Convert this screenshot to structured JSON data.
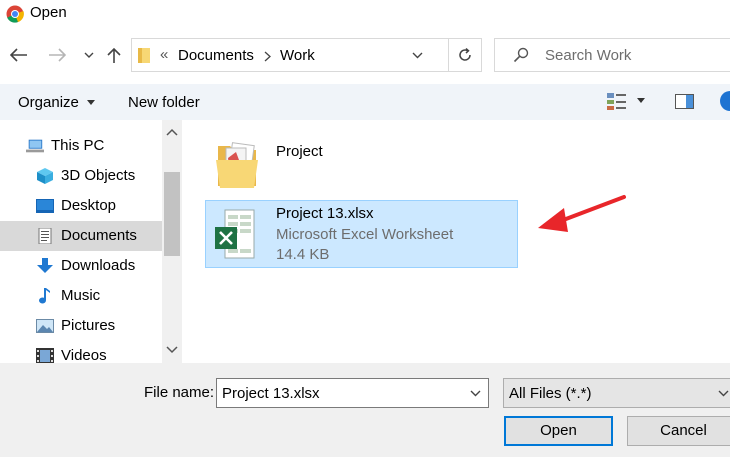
{
  "window": {
    "title": "Open"
  },
  "address": {
    "overflow": "«",
    "crumbs": [
      "Documents",
      "Work"
    ]
  },
  "search": {
    "placeholder": "Search Work"
  },
  "toolbar": {
    "organize": "Organize",
    "new_folder": "New folder"
  },
  "sidebar": {
    "items": [
      {
        "label": "This PC",
        "icon": "computer-icon"
      },
      {
        "label": "3D Objects",
        "icon": "cube-icon"
      },
      {
        "label": "Desktop",
        "icon": "desktop-icon"
      },
      {
        "label": "Documents",
        "icon": "document-icon",
        "selected": true
      },
      {
        "label": "Downloads",
        "icon": "download-arrow-icon"
      },
      {
        "label": "Music",
        "icon": "music-note-icon"
      },
      {
        "label": "Pictures",
        "icon": "picture-icon"
      },
      {
        "label": "Videos",
        "icon": "film-icon"
      }
    ]
  },
  "files": [
    {
      "name": "Project",
      "icon": "folder-icon"
    },
    {
      "name": "Project 13.xlsx",
      "type": "Microsoft Excel Worksheet",
      "size": "14.4 KB",
      "icon": "excel-icon",
      "selected": true
    }
  ],
  "footer": {
    "file_name_label": "File name:",
    "file_name_value": "Project 13.xlsx",
    "filter_value": "All Files (*.*)",
    "open_label": "Open",
    "cancel_label": "Cancel"
  },
  "colors": {
    "selection": "#cce8ff",
    "selection_border": "#99d1ff",
    "arrow": "#e8262a",
    "excel": "#1f7244"
  }
}
